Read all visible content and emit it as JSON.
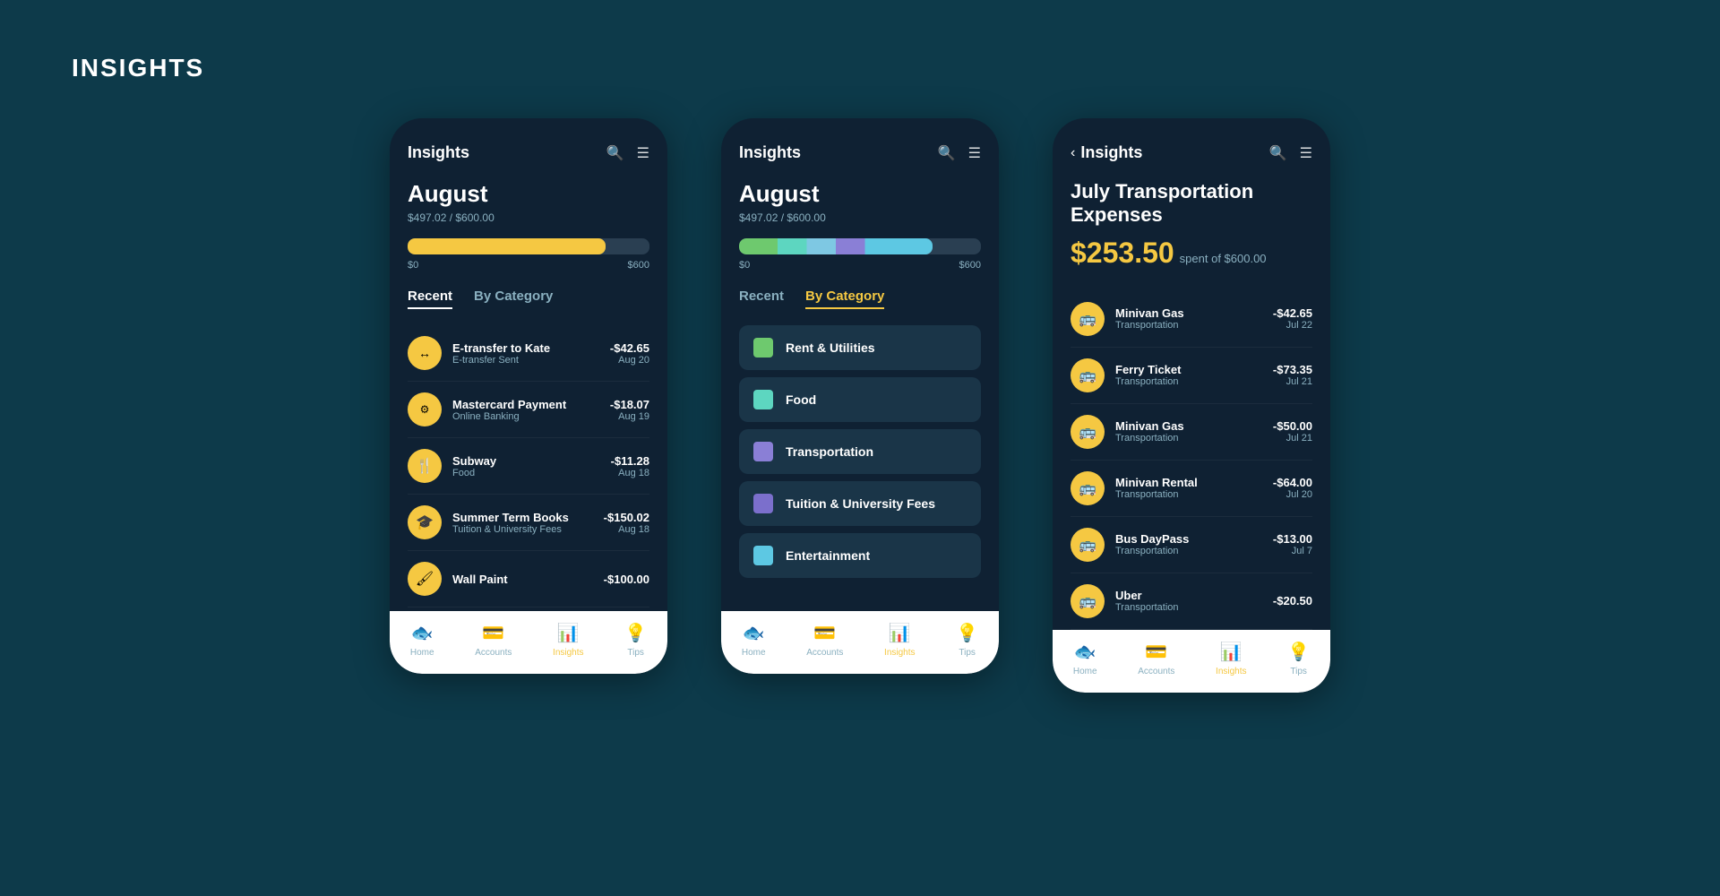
{
  "page": {
    "title": "INSIGHTS"
  },
  "phone1": {
    "header": {
      "title": "Insights"
    },
    "month": "August",
    "subtitle": "$497.02 / $600.00",
    "progress": {
      "label_left": "$0",
      "label_right": "$600"
    },
    "tabs": [
      "Recent",
      "By Category"
    ],
    "active_tab": "Recent",
    "transactions": [
      {
        "icon": "↕",
        "name": "E-transfer to Kate",
        "category": "E-transfer Sent",
        "amount": "-$42.65",
        "date": "Aug 20"
      },
      {
        "icon": "💳",
        "name": "Mastercard Payment",
        "category": "Online Banking",
        "amount": "-$18.07",
        "date": "Aug 19"
      },
      {
        "icon": "🍴",
        "name": "Subway",
        "category": "Food",
        "amount": "-$11.28",
        "date": "Aug 18"
      },
      {
        "icon": "🎓",
        "name": "Summer Term Books",
        "category": "Tuition & University Fees",
        "amount": "-$150.02",
        "date": "Aug 18"
      },
      {
        "icon": "🖌",
        "name": "Wall Paint",
        "category": "",
        "amount": "-$100.00",
        "date": ""
      }
    ],
    "nav": [
      {
        "label": "Home",
        "icon": "🐟",
        "active": false
      },
      {
        "label": "Accounts",
        "icon": "💳",
        "active": false
      },
      {
        "label": "Insights",
        "icon": "📊",
        "active": true
      },
      {
        "label": "Tips",
        "icon": "💡",
        "active": false
      }
    ]
  },
  "phone2": {
    "header": {
      "title": "Insights"
    },
    "month": "August",
    "subtitle": "$497.02 / $600.00",
    "progress": {
      "label_left": "$0",
      "label_right": "$600"
    },
    "tabs": [
      "Recent",
      "By Category"
    ],
    "active_tab": "By Category",
    "categories": [
      {
        "label": "Rent & Utilities",
        "color": "#6ec96e"
      },
      {
        "label": "Food",
        "color": "#5dd6c0"
      },
      {
        "label": "Transportation",
        "color": "#8a7fd6"
      },
      {
        "label": "Tuition & University Fees",
        "color": "#7b6fcc"
      },
      {
        "label": "Entertainment",
        "color": "#5dc8e3"
      }
    ],
    "nav": [
      {
        "label": "Home",
        "icon": "🐟",
        "active": false
      },
      {
        "label": "Accounts",
        "icon": "💳",
        "active": false
      },
      {
        "label": "Insights",
        "icon": "📊",
        "active": true
      },
      {
        "label": "Tips",
        "icon": "💡",
        "active": false
      }
    ]
  },
  "phone3": {
    "header": {
      "title": "Insights"
    },
    "expense_title": "July Transportation Expenses",
    "amount": "$253.50",
    "spent_label": "spent of $600.00",
    "transactions": [
      {
        "name": "Minivan Gas",
        "category": "Transportation",
        "amount": "-$42.65",
        "date": "Jul 22"
      },
      {
        "name": "Ferry Ticket",
        "category": "Transportation",
        "amount": "-$73.35",
        "date": "Jul 21"
      },
      {
        "name": "Minivan Gas",
        "category": "Transportation",
        "amount": "-$50.00",
        "date": "Jul 21"
      },
      {
        "name": "Minivan Rental",
        "category": "Transportation",
        "amount": "-$64.00",
        "date": "Jul 20"
      },
      {
        "name": "Bus DayPass",
        "category": "Transportation",
        "amount": "-$13.00",
        "date": "Jul 7"
      },
      {
        "name": "Uber",
        "category": "Transportation",
        "amount": "-$20.50",
        "date": ""
      }
    ],
    "nav": [
      {
        "label": "Home",
        "icon": "🐟",
        "active": false
      },
      {
        "label": "Accounts",
        "icon": "💳",
        "active": false
      },
      {
        "label": "Insights",
        "icon": "📊",
        "active": true
      },
      {
        "label": "Tips",
        "icon": "💡",
        "active": false
      }
    ]
  }
}
